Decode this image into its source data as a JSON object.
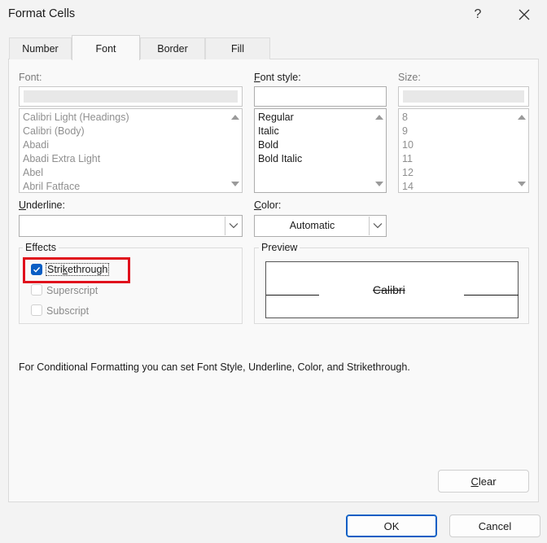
{
  "window": {
    "title": "Format Cells",
    "help_label": "?"
  },
  "tabs": [
    {
      "label": "Number",
      "active": false
    },
    {
      "label": "Font",
      "active": true
    },
    {
      "label": "Border",
      "active": false
    },
    {
      "label": "Fill",
      "active": false
    }
  ],
  "font": {
    "label": "Font:",
    "value": "",
    "items": [
      "Calibri Light (Headings)",
      "Calibri (Body)",
      "Abadi",
      "Abadi Extra Light",
      "Abel",
      "Abril Fatface"
    ]
  },
  "font_style": {
    "label_u": "F",
    "label_rest": "ont style:",
    "value": "",
    "items": [
      "Regular",
      "Italic",
      "Bold",
      "Bold Italic"
    ]
  },
  "size": {
    "label": "Size:",
    "value": "",
    "items": [
      "8",
      "9",
      "10",
      "11",
      "12",
      "14"
    ]
  },
  "underline": {
    "label_u": "U",
    "label_rest": "nderline:",
    "value": ""
  },
  "color": {
    "label_u": "C",
    "label_rest": "olor:",
    "value": "Automatic"
  },
  "effects": {
    "label": "Effects",
    "strikethrough": {
      "label_pre": "Stri",
      "label_u": "k",
      "label_post": "ethrough",
      "checked": true
    },
    "superscript": {
      "label": "Superscript",
      "checked": false
    },
    "subscript": {
      "label": "Subscript",
      "checked": false
    }
  },
  "preview": {
    "label": "Preview",
    "sample": "Calibri"
  },
  "info_text": "For Conditional Formatting you can set Font Style, Underline, Color, and Strikethrough.",
  "buttons": {
    "clear_u": "C",
    "clear_rest": "lear",
    "ok": "OK",
    "cancel": "Cancel"
  },
  "colors": {
    "accent": "#0a5ec4",
    "highlight": "#e0101c"
  }
}
